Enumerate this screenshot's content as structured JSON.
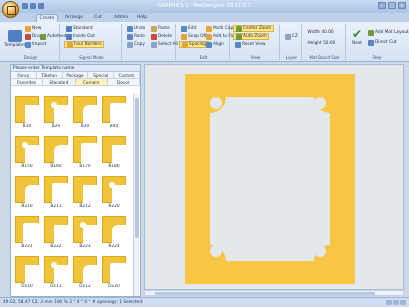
{
  "window": {
    "title": "GRAPHICS 1 - MatDesigner CS 11.0.1"
  },
  "tabs": [
    "Create",
    "Arrange",
    "Cut",
    "Admin",
    "Help"
  ],
  "ribbon": {
    "design": {
      "label": "Design",
      "templates": "Templates",
      "new": "New",
      "draw": "Draw",
      "autofeed": "Autofeed",
      "import": "Import"
    },
    "signal_mode": {
      "label": "Signal Mode",
      "standard": "Standard",
      "inside_out": "Inside Out",
      "four_borders": "Four Borders"
    },
    "clip": {
      "undo": "Undo",
      "redo": "Redo",
      "copy": "Copy",
      "paste": "Paste",
      "delete": "Delete",
      "select_all": "Select All"
    },
    "edit": {
      "label": "Edit",
      "edit": "Edit",
      "snap_off": "Snap Off",
      "spacing": "Spacing",
      "multi_copy": "Multi Copy",
      "add_to_fast": "Add to Fast",
      "align": "Align"
    },
    "view": {
      "label": "View",
      "center_zoom": "Center Zoom",
      "auto_zoom": "Auto Zoom",
      "reset_view": "Reset View",
      "cz": "CZ"
    },
    "layer": {
      "label": "Layer"
    },
    "mat_board": {
      "label": "Mat Board Size",
      "width": "Width 40.00",
      "height": "Height 50.00"
    },
    "step": {
      "label": "Step",
      "next": "Next",
      "add_layout": "Add Mat Layout",
      "direct_cut": "Direct Cut"
    }
  },
  "left_panel": {
    "title": "Please enter Template name",
    "categories_row1": [
      "Fancy",
      "Tibetan",
      "Package",
      "Special",
      "Custom"
    ],
    "categories_row2": [
      "Favorites",
      "Standard",
      "Corners",
      "Decor"
    ],
    "active_category": "Corners",
    "thumbnails": [
      "B10",
      "B20",
      "B30",
      "B40",
      "B150",
      "B160",
      "B170",
      "B180",
      "B210",
      "B211",
      "B212",
      "B220",
      "B221",
      "B222",
      "B223",
      "B224",
      "D110",
      "D111",
      "D112",
      "D120"
    ]
  },
  "status": {
    "text": "49.02, 58.47   C2: 3 mm   100 %   3 ° 0 ° 0 °  # openings: 1   Selected:"
  },
  "colors": {
    "mat": "#f8c644",
    "canvas": "#e4e7ec",
    "ribbon": "#dfe8f5"
  }
}
